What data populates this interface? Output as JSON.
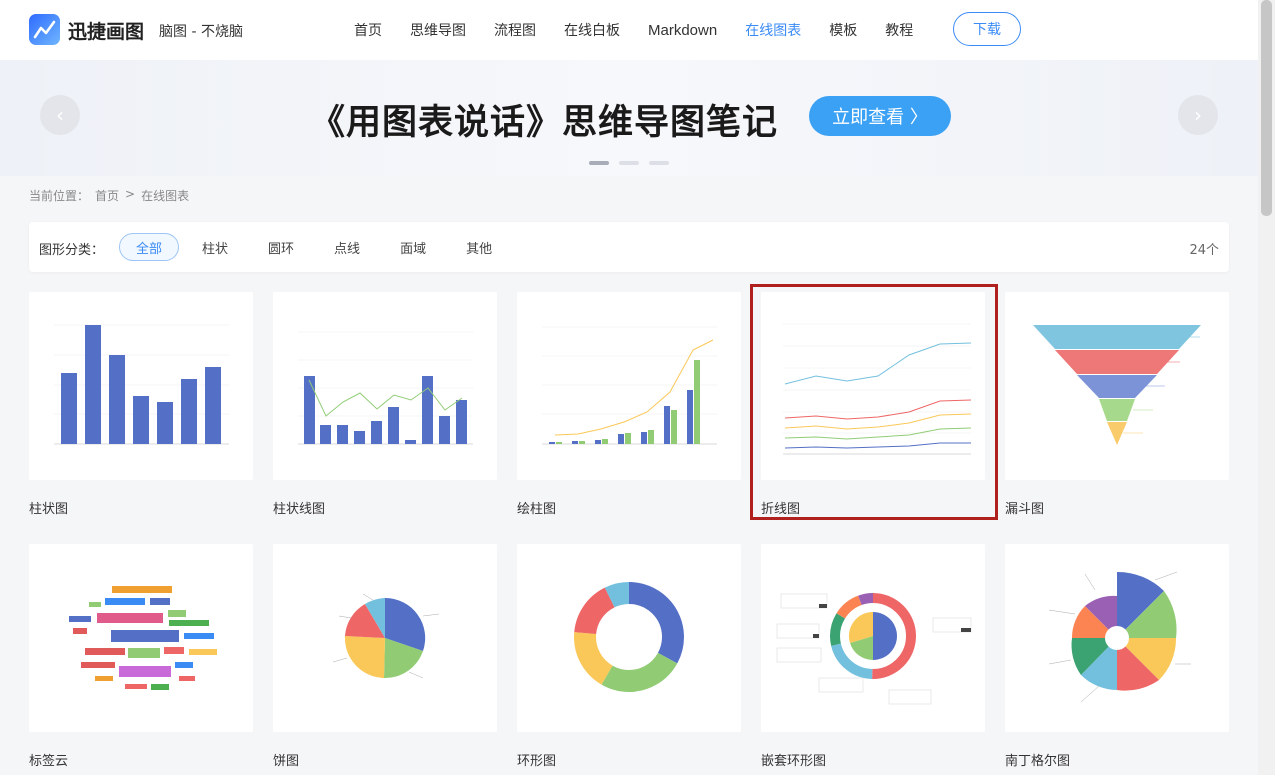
{
  "header": {
    "brand": "迅捷画图",
    "slogan": "脑图 - 不烧脑",
    "nav": [
      "首页",
      "思维导图",
      "流程图",
      "在线白板",
      "Markdown",
      "在线图表",
      "模板",
      "教程"
    ],
    "active_nav": "在线图表",
    "download_label": "下载"
  },
  "banner": {
    "title": "《用图表说话》思维导图笔记",
    "button_label": "立即查看 〉"
  },
  "breadcrumb": {
    "prefix": "当前位置：",
    "home": "首页",
    "separator": ">",
    "current": "在线图表"
  },
  "filter": {
    "label": "图形分类：",
    "tabs": [
      "全部",
      "柱状",
      "圆环",
      "点线",
      "面域",
      "其他"
    ],
    "active_tab": "全部",
    "count": "24个"
  },
  "cards": [
    {
      "title": "柱状图",
      "icon": "bar-chart-thumbnail"
    },
    {
      "title": "柱状线图",
      "icon": "bar-line-chart-thumbnail"
    },
    {
      "title": "绘柱图",
      "icon": "grouped-bar-chart-thumbnail"
    },
    {
      "title": "折线图",
      "icon": "line-chart-thumbnail"
    },
    {
      "title": "漏斗图",
      "icon": "funnel-chart-thumbnail"
    },
    {
      "title": "标签云",
      "icon": "word-cloud-thumbnail"
    },
    {
      "title": "饼图",
      "icon": "pie-chart-thumbnail"
    },
    {
      "title": "环形图",
      "icon": "donut-chart-thumbnail"
    },
    {
      "title": "嵌套环形图",
      "icon": "nested-donut-thumbnail"
    },
    {
      "title": "南丁格尔图",
      "icon": "nightingale-chart-thumbnail"
    }
  ],
  "colors": {
    "accent": "#3b8bf5",
    "highlight_border": "#b0201c"
  }
}
